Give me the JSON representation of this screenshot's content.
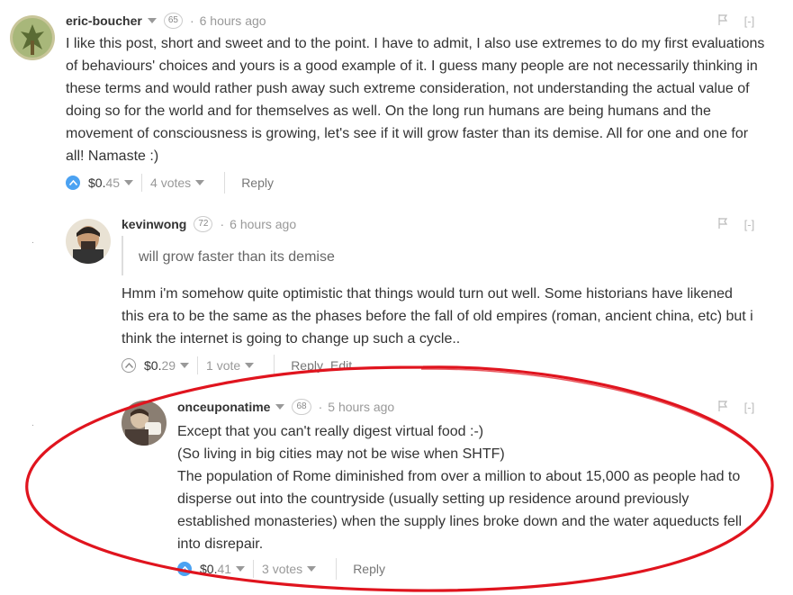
{
  "comments": [
    {
      "author": "eric-boucher",
      "reputation": "65",
      "time": "6 hours ago",
      "flag_icon": "flag-icon",
      "collapse": "[-]",
      "paragraphs": [
        "I like this post, short and sweet and to the point. I have to admit, I also use extremes to do my first evaluations",
        "of behaviours' choices and yours is a good example of it. I guess many people are not necessarily thinking in",
        "these terms and would rather push away such extreme consideration, not understanding the actual value of",
        "doing so for the world and for themselves as well. On the long run humans are being humans and the",
        "movement of consciousness is growing, let's see if it will grow faster than its demise. All for one and one for",
        "all! Namaste :)"
      ],
      "payout_main": "$0.",
      "payout_cents": "45",
      "votes": "4 votes",
      "reply": "Reply"
    },
    {
      "author": "kevinwong",
      "reputation": "72",
      "time": "6 hours ago",
      "collapse": "[-]",
      "quote": "will grow faster than its demise",
      "paragraphs": [
        "Hmm i'm somehow quite optimistic that things would turn out well. Some historians have likened",
        "this era to be the same as the phases before the fall of old empires (roman, ancient china, etc) but i",
        "think the internet is going to change up such a cycle.."
      ],
      "payout_main": "$0.",
      "payout_cents": "29",
      "votes": "1 vote",
      "reply": "Reply",
      "edit": "Edit"
    },
    {
      "author": "onceuponatime",
      "reputation": "68",
      "time": "5 hours ago",
      "collapse": "[-]",
      "paragraphs": [
        "Except that you can't really digest virtual food :-)",
        "(So living in big cities may not be wise when SHTF)",
        "The population of Rome diminished from over a million to about 15,000 as people had to",
        "disperse out into the countryside (usually setting up residence around previously",
        "established monasteries) when the supply lines broke down and the water aqueducts fell",
        "into disrepair."
      ],
      "payout_main": "$0.",
      "payout_cents": "41",
      "votes": "3 votes",
      "reply": "Reply"
    }
  ],
  "colors": {
    "accent": "#4ba2f2",
    "annotation": "#e0141e"
  }
}
